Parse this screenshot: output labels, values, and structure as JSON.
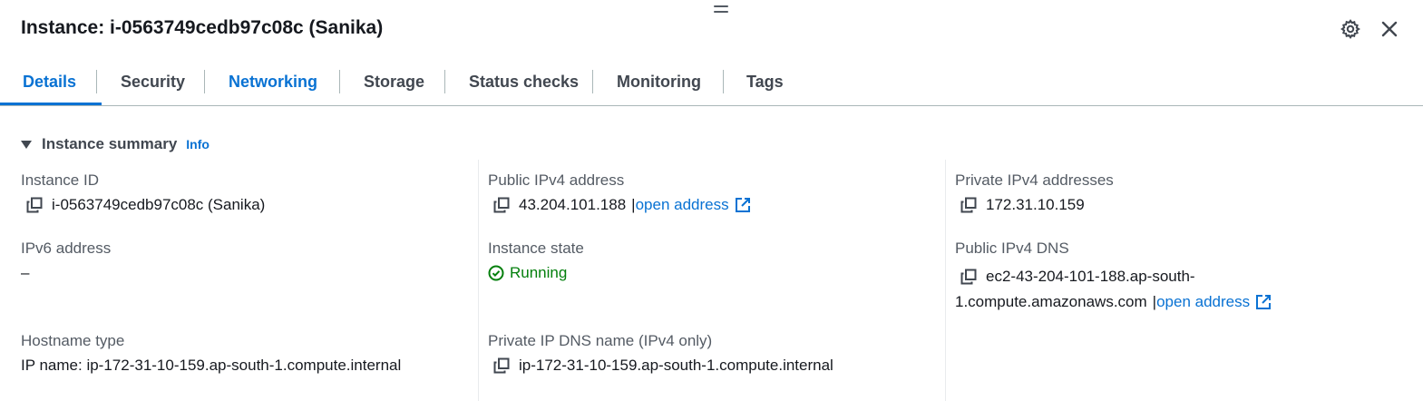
{
  "header": {
    "title": "Instance: i-0563749cedb97c08c (Sanika)",
    "icons": {
      "settings": "gear-icon",
      "close": "close-icon",
      "drag": "drag-handle-icon"
    }
  },
  "tabs": [
    {
      "label": "Details",
      "state": "active"
    },
    {
      "label": "Security",
      "state": "default"
    },
    {
      "label": "Networking",
      "state": "link"
    },
    {
      "label": "Storage",
      "state": "default"
    },
    {
      "label": "Status checks",
      "state": "default"
    },
    {
      "label": "Monitoring",
      "state": "default"
    },
    {
      "label": "Tags",
      "state": "default"
    }
  ],
  "summary": {
    "title": "Instance summary",
    "info_label": "Info"
  },
  "fields": {
    "instance_id": {
      "label": "Instance ID",
      "value": "i-0563749cedb97c08c (Sanika)"
    },
    "public_ipv4": {
      "label": "Public IPv4 address",
      "value": "43.204.101.188",
      "separator": "|",
      "link": "open address"
    },
    "private_ipv4": {
      "label": "Private IPv4 addresses",
      "value": "172.31.10.159"
    },
    "ipv6": {
      "label": "IPv6 address",
      "value": "–"
    },
    "instance_state": {
      "label": "Instance state",
      "value": "Running"
    },
    "public_dns": {
      "label": "Public IPv4 DNS",
      "value_line1": "ec2-43-204-101-188.ap-south-",
      "value_line2": "1.compute.amazonaws.com",
      "separator": "|",
      "link": "open address"
    },
    "hostname_type": {
      "label": "Hostname type",
      "value": "IP name: ip-172-31-10-159.ap-south-1.compute.internal"
    },
    "private_dns": {
      "label": "Private IP DNS name (IPv4 only)",
      "value": "ip-172-31-10-159.ap-south-1.compute.internal"
    }
  },
  "colors": {
    "link": "#0972d3",
    "success": "#037f0c",
    "text": "#16191f",
    "label": "#545b64",
    "border": "#aab7b8"
  }
}
